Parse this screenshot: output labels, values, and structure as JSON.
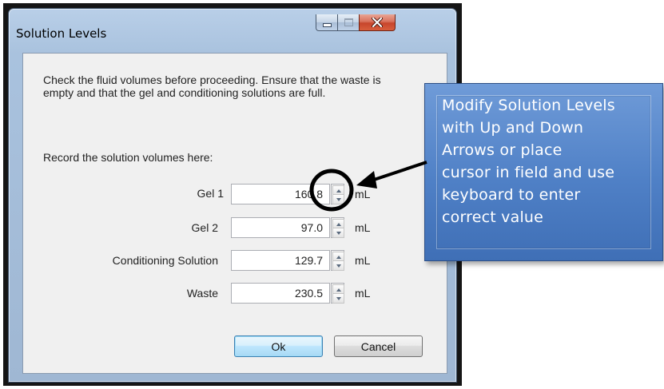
{
  "window": {
    "title": "Solution Levels",
    "caption_buttons": [
      "minimize",
      "maximize",
      "close"
    ]
  },
  "dialog": {
    "instructions": "Check the fluid volumes before proceeding. Ensure that the waste is empty and that the gel and conditioning solutions are full.",
    "record_label": "Record the solution volumes here:",
    "rows": [
      {
        "label": "Gel 1",
        "value": "160.8",
        "unit": "mL"
      },
      {
        "label": "Gel 2",
        "value": "97.0",
        "unit": "mL"
      },
      {
        "label": "Conditioning Solution",
        "value": "129.7",
        "unit": "mL"
      },
      {
        "label": "Waste",
        "value": "230.5",
        "unit": "mL"
      }
    ],
    "ok_label": "Ok",
    "cancel_label": "Cancel"
  },
  "callout": {
    "lines": [
      "Modify Solution Levels",
      "with Up and Down",
      "Arrows or place",
      "cursor in field and use",
      "keyboard to enter",
      "correct value"
    ],
    "color": "#4f80c6"
  }
}
